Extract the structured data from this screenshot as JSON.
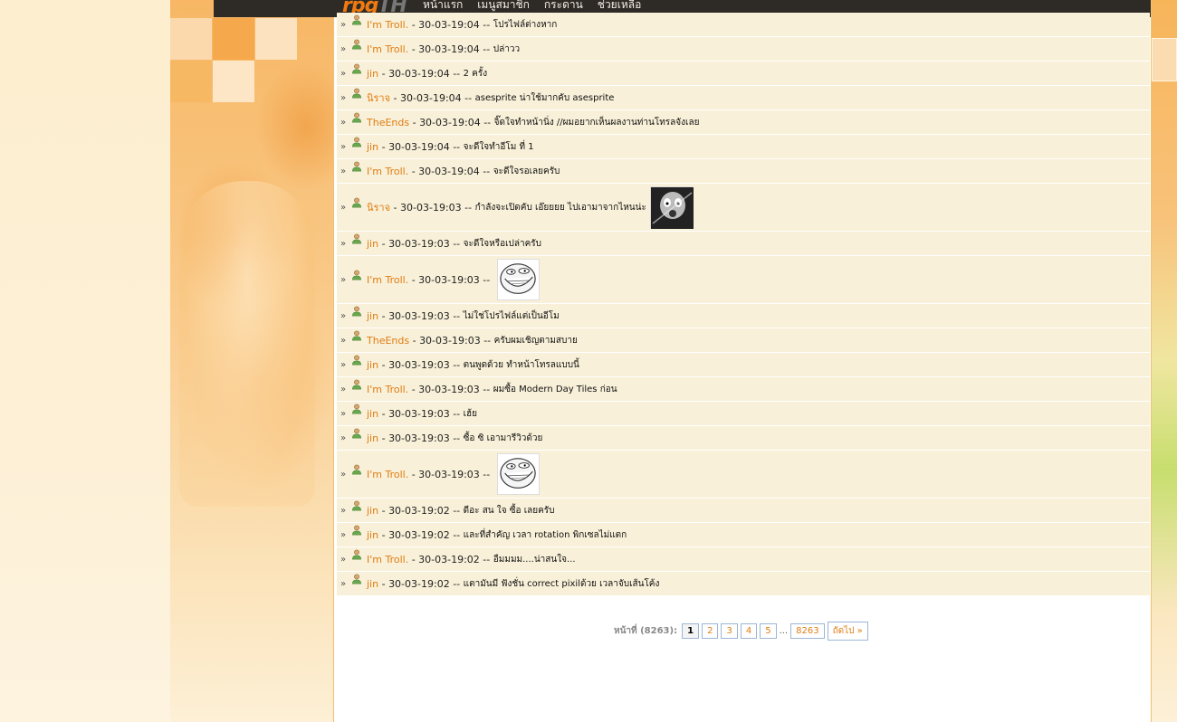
{
  "nav": {
    "logo": "rpg",
    "logo_suffix": "TH",
    "items": [
      "หน้าแรก",
      "เมนูสมาชิก",
      "กระดาน",
      "ช่วยเหลือ"
    ]
  },
  "messages": [
    {
      "user": "I'm Troll.",
      "time": "30-03-19:04",
      "text": "โปรไฟล์ต่างหาก"
    },
    {
      "user": "I'm Troll.",
      "time": "30-03-19:04",
      "text": "ปล่าวว"
    },
    {
      "user": "jin",
      "time": "30-03-19:04",
      "text": "2 ครั้ง"
    },
    {
      "user": "นิราจ",
      "time": "30-03-19:04",
      "text": "asesprite น่าใช้มากคับ asesprite"
    },
    {
      "user": "TheEnds",
      "time": "30-03-19:04",
      "text": "จิ๊ดใจทำหน้านิ่ง //ผมอยากเห็นผลงานท่านโทรลจังเลย"
    },
    {
      "user": "jin",
      "time": "30-03-19:04",
      "text": "จะดีใจทำอีโม ที่ 1"
    },
    {
      "user": "I'm Troll.",
      "time": "30-03-19:04",
      "text": "จะดีใจรอเลยครับ"
    },
    {
      "user": "นิราจ",
      "time": "30-03-19:03",
      "text": "กำลังจะเปิดคับ เอ๊ยยยย ไปเอามาจากไหนน่ะ",
      "emote": "shock"
    },
    {
      "user": "jin",
      "time": "30-03-19:03",
      "text": "จะดีใจหรือเปล่าครับ"
    },
    {
      "user": "I'm Troll.",
      "time": "30-03-19:03",
      "text": "",
      "emote": "trollface"
    },
    {
      "user": "jin",
      "time": "30-03-19:03",
      "text": "ไม่ใช่โปรไฟล์แต่เป็นอีโม"
    },
    {
      "user": "TheEnds",
      "time": "30-03-19:03",
      "text": "ครับผมเชิญตามสบาย"
    },
    {
      "user": "jin",
      "time": "30-03-19:03",
      "text": "ตนพูดด้วย ทำหน้าโทรลแบบนี้"
    },
    {
      "user": "I'm Troll.",
      "time": "30-03-19:03",
      "text": "ผมซื้อ Modern Day Tiles ก่อน"
    },
    {
      "user": "jin",
      "time": "30-03-19:03",
      "text": "เฮ้ย"
    },
    {
      "user": "jin",
      "time": "30-03-19:03",
      "text": "ซื้อ ซิ เอามารีวิวด้วย"
    },
    {
      "user": "I'm Troll.",
      "time": "30-03-19:03",
      "text": "",
      "emote": "trollface"
    },
    {
      "user": "jin",
      "time": "30-03-19:02",
      "text": "ดีอะ สน ใจ ซื้อ เลยครับ"
    },
    {
      "user": "jin",
      "time": "30-03-19:02",
      "text": "และที่สำคัญ เวลา rotation พิกเซลไม่แตก"
    },
    {
      "user": "I'm Troll.",
      "time": "30-03-19:02",
      "text": "อืมมมม....น่าสนใจ..."
    },
    {
      "user": "jin",
      "time": "30-03-19:02",
      "text": "แตามันมี ฟังชั่น correct pixilด้วย เวลาจับเส้นโค้ง"
    }
  ],
  "pager": {
    "label": "หน้าที่ (8263):",
    "pages": [
      "1",
      "2",
      "3",
      "4",
      "5"
    ],
    "ellipsis": "...",
    "last": "8263",
    "next": "ถัดไป »",
    "current": "1"
  },
  "colors": {
    "username": "#e07d13",
    "row_bg": "#f8f0d8",
    "nav_bg": "#2e2a25"
  }
}
